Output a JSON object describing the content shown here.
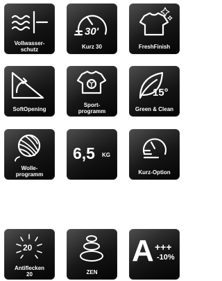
{
  "tiles": {
    "vollwasserschutz": {
      "line1": "Vollwasser-",
      "line2": "schutz"
    },
    "kurz30": {
      "label": "Kurz 30",
      "symbol": "30'"
    },
    "freshfinish": {
      "label": "FreshFinish"
    },
    "softopening": {
      "label": "SoftOpening"
    },
    "sportprogramm": {
      "line1": "Sport-",
      "line2": "programm"
    },
    "greenclean": {
      "label": "Green & Clean",
      "temp": "15°"
    },
    "wolleprogramm": {
      "line1": "Wolle-",
      "line2": "programm"
    },
    "capacity": {
      "value": "6,5",
      "unit": "KG"
    },
    "kurzoption": {
      "label": "Kurz-Option"
    },
    "antiflecken": {
      "line1": "Antiflecken",
      "line2": "20",
      "badge": "20"
    },
    "zen": {
      "label": "ZEN"
    },
    "energy": {
      "letter": "A",
      "plus": "+++",
      "percent": "-10%"
    }
  },
  "colors": {
    "tile_bg": "#141414",
    "icon": "#ffffff"
  }
}
